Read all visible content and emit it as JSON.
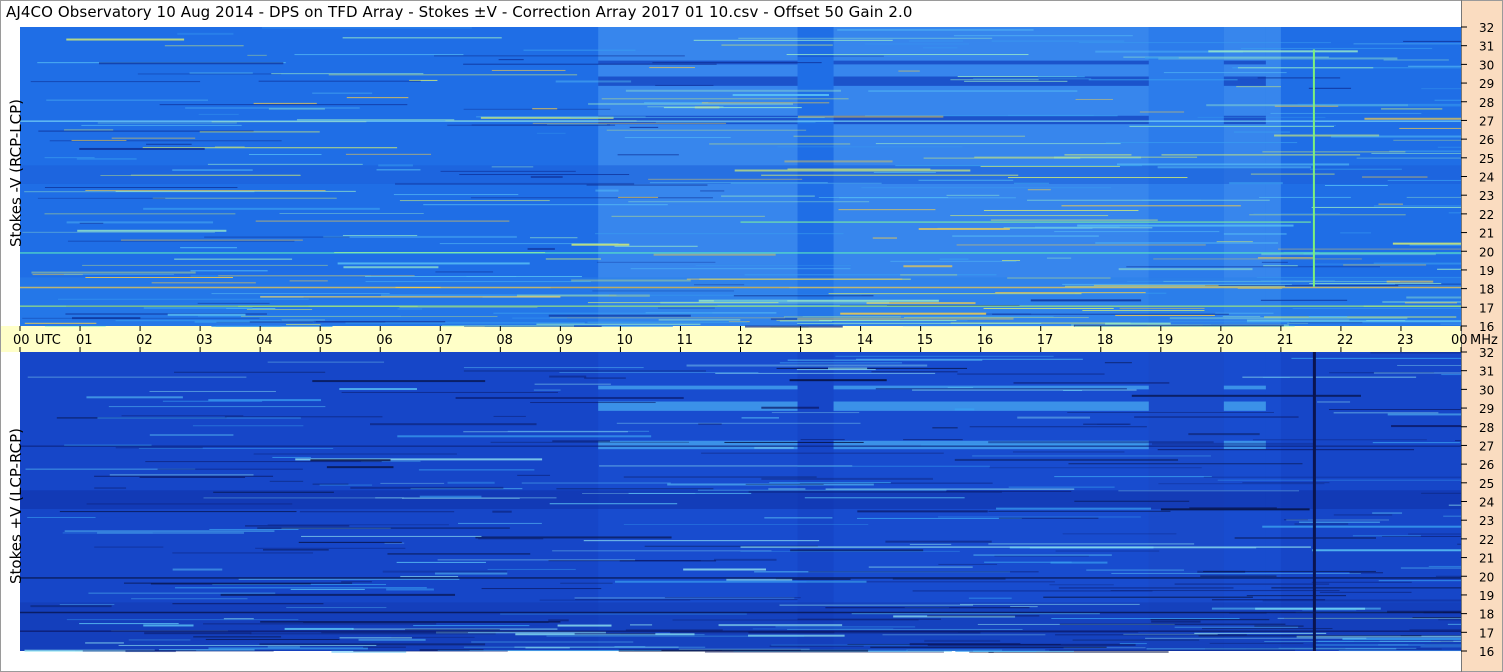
{
  "title": "AJ4CO Observatory  10 Aug 2014  -  DPS on TFD Array  -  Stokes ±V  -  Correction Array 2017 01 10.csv  -  Offset 50  Gain 2.0",
  "chart_data": [
    {
      "type": "heatmap",
      "panel": "top",
      "ylabel": "Stokes -V  (RCP-LCP)",
      "y_unit": "MHz",
      "y_ticks": [
        "32",
        "31",
        "30",
        "29",
        "28",
        "27",
        "26",
        "25",
        "24",
        "23",
        "22",
        "21",
        "20",
        "19",
        "18",
        "17",
        "16"
      ],
      "ylim": [
        16,
        32
      ],
      "xlim": [
        "00",
        "00"
      ],
      "colormap": "blue-cyan-yellow-red",
      "base_color": "#1f6ee6"
    },
    {
      "type": "heatmap",
      "panel": "bottom",
      "ylabel": "Stokes +V  (LCP-RCP)",
      "y_unit": "MHz",
      "y_ticks": [
        "32",
        "31",
        "30",
        "29",
        "28",
        "27",
        "26",
        "25",
        "24",
        "23",
        "22",
        "21",
        "20",
        "19",
        "18",
        "17",
        "16"
      ],
      "ylim": [
        16,
        32
      ],
      "xlim": [
        "00",
        "00"
      ],
      "colormap": "blue-cyan-yellow-red",
      "base_color": "#1646c8"
    }
  ],
  "time_axis": {
    "unit_label": "UTC",
    "end_unit": "MHz",
    "ticks": [
      "00",
      "01",
      "02",
      "03",
      "04",
      "05",
      "06",
      "07",
      "08",
      "09",
      "10",
      "11",
      "12",
      "13",
      "14",
      "15",
      "16",
      "17",
      "18",
      "19",
      "20",
      "21",
      "22",
      "23",
      "00"
    ]
  },
  "colors": {
    "axis_strip": "#ffffc8",
    "right_strip": "#fadcc0",
    "top_base": "#1f6ee6",
    "bottom_base": "#1646c8",
    "burst_top": "#7cf07c",
    "burst_bottom": "#0a1450"
  }
}
